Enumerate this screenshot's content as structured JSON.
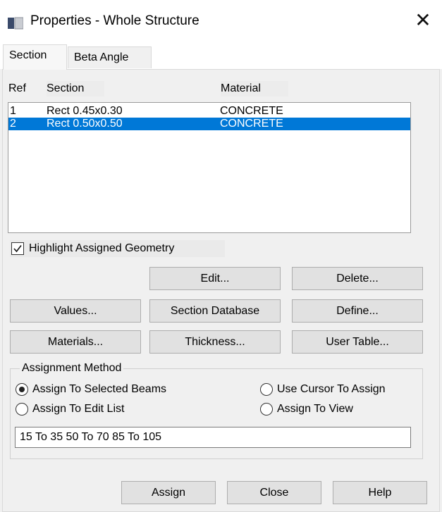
{
  "window": {
    "title": "Properties - Whole Structure",
    "close_glyph": "✕"
  },
  "tabs": [
    {
      "label": "Section",
      "active": true
    },
    {
      "label": "Beta Angle",
      "active": false
    }
  ],
  "table": {
    "headers": {
      "ref": "Ref",
      "section": "Section",
      "material": "Material"
    },
    "rows": [
      {
        "ref": "1",
        "section": "Rect 0.45x0.30",
        "material": "CONCRETE",
        "selected": false
      },
      {
        "ref": "2",
        "section": "Rect 0.50x0.50",
        "material": "CONCRETE",
        "selected": true
      }
    ]
  },
  "highlight_checkbox": {
    "label": "Highlight Assigned Geometry",
    "checked": true
  },
  "buttons": {
    "edit": "Edit...",
    "delete": "Delete...",
    "values": "Values...",
    "section_database": "Section Database",
    "define": "Define...",
    "materials": "Materials...",
    "thickness": "Thickness...",
    "user_table": "User Table...",
    "assign": "Assign",
    "close": "Close",
    "help": "Help"
  },
  "assignment": {
    "legend": "Assignment Method",
    "options": [
      {
        "label": "Assign To Selected Beams",
        "checked": true
      },
      {
        "label": "Use Cursor To Assign",
        "checked": false
      },
      {
        "label": "Assign To Edit List",
        "checked": false
      },
      {
        "label": "Assign To View",
        "checked": false
      }
    ],
    "edit_list_value": "15 To 35 50 To 70 85 To 105"
  },
  "colors": {
    "selection": "#0078d7",
    "dialog_bg": "#f0f0f0",
    "button_bg": "#e1e1e1"
  }
}
